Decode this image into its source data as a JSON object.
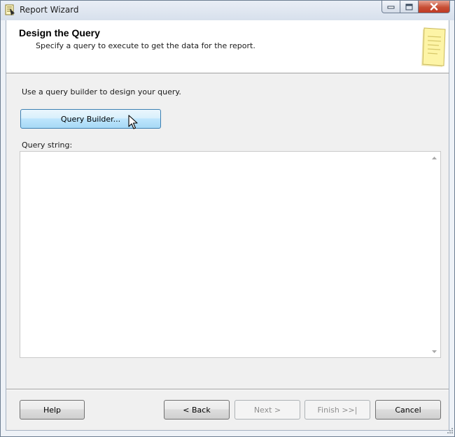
{
  "window": {
    "title": "Report Wizard",
    "controls": {
      "minimize_icon": "minimize-icon",
      "maximize_icon": "maximize-icon",
      "close_icon": "close-icon"
    }
  },
  "header": {
    "title": "Design the Query",
    "subtitle": "Specify a query to execute to get the data for the report.",
    "art_icon": "report-document-icon"
  },
  "main": {
    "instruction": "Use a query builder to design your query.",
    "query_builder_label": "Query Builder...",
    "query_string_label": "Query string:",
    "query_string_value": ""
  },
  "footer": {
    "help_label": "Help",
    "back_label": "< Back",
    "next_label": "Next >",
    "finish_label": "Finish >>|",
    "cancel_label": "Cancel",
    "next_enabled": false,
    "finish_enabled": false
  },
  "colors": {
    "accent_button": "#bee6fd",
    "close_button": "#c74f35",
    "header_background": "#ffffff",
    "panel_background": "#f0f0f0"
  }
}
